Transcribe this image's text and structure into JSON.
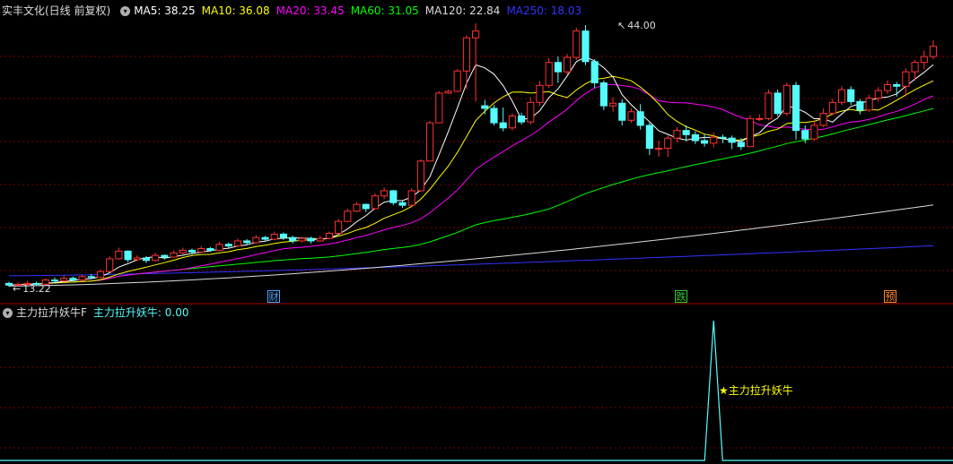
{
  "main_panel": {
    "title": "实丰文化(日线 前复权)",
    "ma_labels": [
      {
        "text": "MA5: 38.25",
        "color": "#ffffff"
      },
      {
        "text": "MA10: 36.08",
        "color": "#ffff00"
      },
      {
        "text": "MA20: 33.45",
        "color": "#ff00ff"
      },
      {
        "text": "MA60: 31.05",
        "color": "#00ff00"
      },
      {
        "text": "MA120: 22.84",
        "color": "#dcdcdc"
      },
      {
        "text": "MA250: 18.03",
        "color": "#3333ff"
      }
    ],
    "high_label": "44.00",
    "low_label": "13.22",
    "markers": [
      {
        "text": "财",
        "color": "#4da6ff"
      },
      {
        "text": "跌",
        "color": "#33cc33"
      },
      {
        "text": "预",
        "color": "#ff8833"
      }
    ]
  },
  "indicator_panel": {
    "title": "主力拉升妖牛F",
    "value_label": "主力拉升妖牛: 0.00",
    "signal_label": "主力拉升妖牛",
    "signal_icon": "star-icon"
  },
  "colors": {
    "up": "#ff3232",
    "down": "#54fcfc",
    "grid": "#7a0000",
    "ma5": "#ffffff",
    "ma10": "#ffff00",
    "ma20": "#ff00ff",
    "ma60": "#00ff00",
    "ma120": "#dcdcdc",
    "ma250": "#3333ff"
  },
  "chart_data": {
    "type": "candlestick",
    "price_range": [
      13.22,
      44.0
    ],
    "candles": [
      [
        13.6,
        13.4,
        13.8,
        13.2
      ],
      [
        13.4,
        13.5,
        13.7,
        13.3
      ],
      [
        13.5,
        13.6,
        13.9,
        13.4
      ],
      [
        13.6,
        13.5,
        13.8,
        13.3
      ],
      [
        13.5,
        14.0,
        14.2,
        13.4
      ],
      [
        14.0,
        13.9,
        14.3,
        13.7
      ],
      [
        13.9,
        14.2,
        14.5,
        13.8
      ],
      [
        14.2,
        14.0,
        14.4,
        13.9
      ],
      [
        14.0,
        14.4,
        14.6,
        13.9
      ],
      [
        14.4,
        14.3,
        14.7,
        14.1
      ],
      [
        14.3,
        15.0,
        15.2,
        14.2
      ],
      [
        15.0,
        16.5,
        16.8,
        14.9
      ],
      [
        16.5,
        17.4,
        17.8,
        16.4
      ],
      [
        17.4,
        16.4,
        17.5,
        16.1
      ],
      [
        16.4,
        16.6,
        16.9,
        16.2
      ],
      [
        16.6,
        16.3,
        16.8,
        16.0
      ],
      [
        16.3,
        16.9,
        17.2,
        16.2
      ],
      [
        16.9,
        16.7,
        17.0,
        16.4
      ],
      [
        16.7,
        17.2,
        17.5,
        16.6
      ],
      [
        17.2,
        17.5,
        17.8,
        17.0
      ],
      [
        17.5,
        17.3,
        17.7,
        17.0
      ],
      [
        17.3,
        17.7,
        18.0,
        17.2
      ],
      [
        17.7,
        17.5,
        17.9,
        17.3
      ],
      [
        17.5,
        18.2,
        18.5,
        17.4
      ],
      [
        18.2,
        18.0,
        18.4,
        17.8
      ],
      [
        18.0,
        18.6,
        18.9,
        17.9
      ],
      [
        18.6,
        18.4,
        18.8,
        18.1
      ],
      [
        18.4,
        19.0,
        19.3,
        18.3
      ],
      [
        19.0,
        18.8,
        19.2,
        18.5
      ],
      [
        18.8,
        19.4,
        19.7,
        18.7
      ],
      [
        19.4,
        19.0,
        19.6,
        18.7
      ],
      [
        19.0,
        18.6,
        19.2,
        18.3
      ],
      [
        18.6,
        18.9,
        19.1,
        18.4
      ],
      [
        18.9,
        18.6,
        19.1,
        18.3
      ],
      [
        18.6,
        18.9,
        19.2,
        18.5
      ],
      [
        18.9,
        19.5,
        19.7,
        18.8
      ],
      [
        19.5,
        20.9,
        21.2,
        19.4
      ],
      [
        20.9,
        22.1,
        22.4,
        20.8
      ],
      [
        22.1,
        22.9,
        23.2,
        22.0
      ],
      [
        22.9,
        22.4,
        23.0,
        22.0
      ],
      [
        22.4,
        23.9,
        24.2,
        22.3
      ],
      [
        23.9,
        24.5,
        24.9,
        23.5
      ],
      [
        24.5,
        23.1,
        24.6,
        22.8
      ],
      [
        23.1,
        22.8,
        23.3,
        22.5
      ],
      [
        22.8,
        24.5,
        24.8,
        22.7
      ],
      [
        24.5,
        28.0,
        28.2,
        24.4
      ],
      [
        28.0,
        32.5,
        32.7,
        28.0
      ],
      [
        32.5,
        36.0,
        36.2,
        32.5
      ],
      [
        36.0,
        36.2,
        36.4,
        35.9
      ],
      [
        36.2,
        38.6,
        38.8,
        36.1
      ],
      [
        38.6,
        42.5,
        42.8,
        36.5
      ],
      [
        42.5,
        43.3,
        44.2,
        35.0
      ],
      [
        34.5,
        34.2,
        35.2,
        33.5
      ],
      [
        34.2,
        32.5,
        34.6,
        32.2
      ],
      [
        32.5,
        31.9,
        34.3,
        31.5
      ],
      [
        31.9,
        33.3,
        33.6,
        31.6
      ],
      [
        33.3,
        32.6,
        33.7,
        32.3
      ],
      [
        32.6,
        34.9,
        35.5,
        32.3
      ],
      [
        34.9,
        36.9,
        37.4,
        34.5
      ],
      [
        36.9,
        39.6,
        40.1,
        36.6
      ],
      [
        39.6,
        38.5,
        40.3,
        37.2
      ],
      [
        38.5,
        40.2,
        40.6,
        38.2
      ],
      [
        40.2,
        43.3,
        43.7,
        39.9
      ],
      [
        43.3,
        39.7,
        44.0,
        39.3
      ],
      [
        39.7,
        37.2,
        40.0,
        36.6
      ],
      [
        37.2,
        34.5,
        37.5,
        34.0
      ],
      [
        34.5,
        34.8,
        35.5,
        33.8
      ],
      [
        34.8,
        32.8,
        35.3,
        32.2
      ],
      [
        32.8,
        33.8,
        34.2,
        32.5
      ],
      [
        33.8,
        32.2,
        34.7,
        31.7
      ],
      [
        32.2,
        29.5,
        32.5,
        28.7
      ],
      [
        29.5,
        29.5,
        30.4,
        28.5
      ],
      [
        29.5,
        30.7,
        31.0,
        28.5
      ],
      [
        30.7,
        31.6,
        32.0,
        30.2
      ],
      [
        31.6,
        31.1,
        32.2,
        30.3
      ],
      [
        31.1,
        30.4,
        31.5,
        30.0
      ],
      [
        30.4,
        30.1,
        31.2,
        29.7
      ],
      [
        30.1,
        30.8,
        31.4,
        29.6
      ],
      [
        30.8,
        30.7,
        31.1,
        30.1
      ],
      [
        30.7,
        30.2,
        31.0,
        29.4
      ],
      [
        30.2,
        29.7,
        30.7,
        29.3
      ],
      [
        29.7,
        33.0,
        33.4,
        29.7
      ],
      [
        33.0,
        33.0,
        33.5,
        32.7
      ],
      [
        33.0,
        36.0,
        36.4,
        32.8
      ],
      [
        36.0,
        33.6,
        36.4,
        33.3
      ],
      [
        33.6,
        36.9,
        37.2,
        33.3
      ],
      [
        36.9,
        31.6,
        37.3,
        30.5
      ],
      [
        31.6,
        30.6,
        32.2,
        30.1
      ],
      [
        30.6,
        32.2,
        32.8,
        30.4
      ],
      [
        32.2,
        33.6,
        34.2,
        32.0
      ],
      [
        33.6,
        34.9,
        35.3,
        33.4
      ],
      [
        34.9,
        36.4,
        36.8,
        34.6
      ],
      [
        36.4,
        35.0,
        36.8,
        34.6
      ],
      [
        35.0,
        34.0,
        35.3,
        33.5
      ],
      [
        34.0,
        35.4,
        35.8,
        33.8
      ],
      [
        35.4,
        36.3,
        36.7,
        35.0
      ],
      [
        36.3,
        37.0,
        37.5,
        35.9
      ],
      [
        37.0,
        36.8,
        37.3,
        35.6
      ],
      [
        36.8,
        38.5,
        38.9,
        35.6
      ],
      [
        38.5,
        39.6,
        39.9,
        37.5
      ],
      [
        39.6,
        40.3,
        41.0,
        38.8
      ],
      [
        40.3,
        41.5,
        42.2,
        40.0
      ]
    ],
    "ma250_range": [
      14.5,
      18.03
    ],
    "ma120_range": [
      13.3,
      22.84
    ],
    "indicator": {
      "value_range": [
        0,
        1
      ],
      "signal_bar_index": 77,
      "value": 0.0
    }
  }
}
